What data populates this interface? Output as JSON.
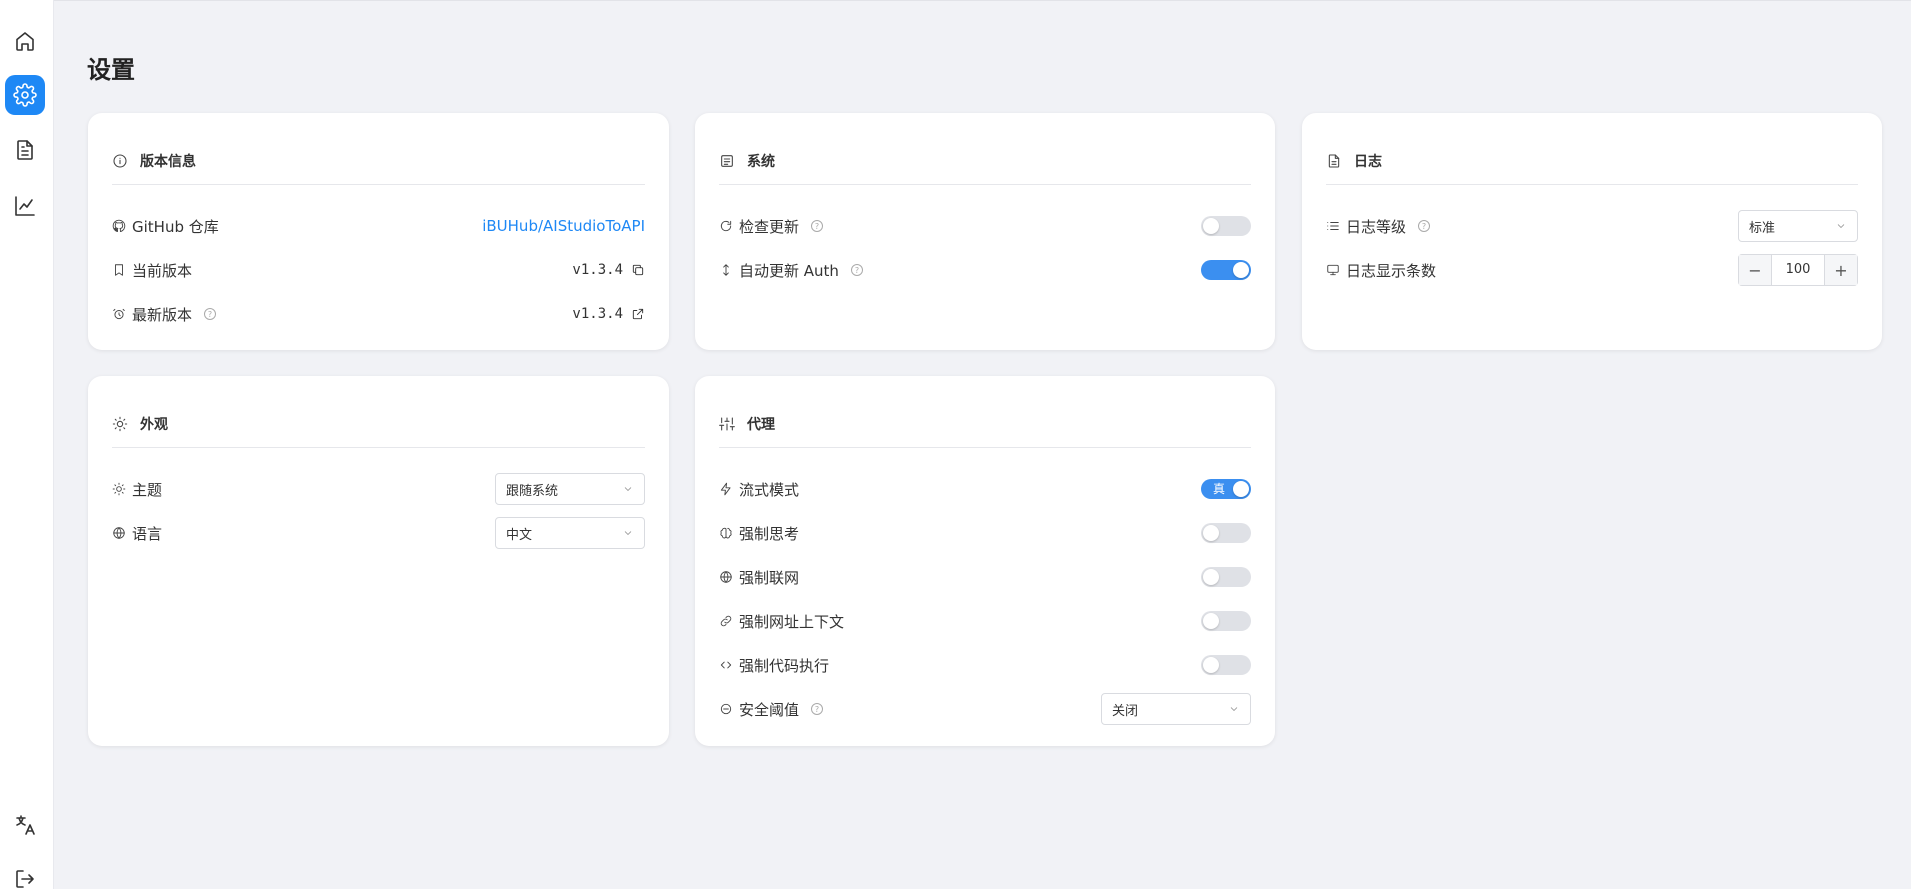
{
  "page": {
    "title": "设置"
  },
  "sidebar": {
    "items": [
      {
        "icon": "home-icon",
        "active": false
      },
      {
        "icon": "gear-icon",
        "active": true
      },
      {
        "icon": "document-icon",
        "active": false
      },
      {
        "icon": "chart-icon",
        "active": false
      },
      {
        "icon": "translate-icon",
        "active": false
      },
      {
        "icon": "logout-icon",
        "active": false
      }
    ]
  },
  "version_card": {
    "title": "版本信息",
    "github_label": "GitHub 仓库",
    "github_link": "iBUHub/AIStudioToAPI",
    "current_label": "当前版本",
    "current_value": "v1.3.4",
    "latest_label": "最新版本",
    "latest_value": "v1.3.4"
  },
  "system_card": {
    "title": "系统",
    "check_update_label": "检查更新",
    "check_update_on": false,
    "auto_update_label": "自动更新 Auth",
    "auto_update_on": true
  },
  "log_card": {
    "title": "日志",
    "level_label": "日志等级",
    "level_value": "标准",
    "count_label": "日志显示条数",
    "count_value": "100",
    "minus": "−",
    "plus": "+"
  },
  "appearance_card": {
    "title": "外观",
    "theme_label": "主题",
    "theme_value": "跟随系统",
    "language_label": "语言",
    "language_value": "中文"
  },
  "proxy_card": {
    "title": "代理",
    "stream_label": "流式模式",
    "stream_toggle_text": "真",
    "stream_on": true,
    "force_think_label": "强制思考",
    "force_web_label": "强制联网",
    "force_url_label": "强制网址上下文",
    "force_code_label": "强制代码执行",
    "safety_label": "安全阈值",
    "safety_value": "关闭"
  },
  "colors": {
    "accent": "#1e88f5",
    "background": "#f1f2f6"
  }
}
